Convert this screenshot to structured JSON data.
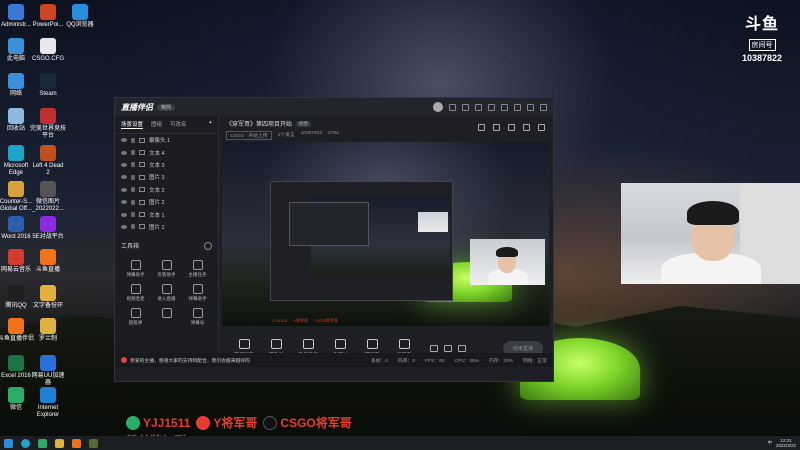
{
  "desktop": {
    "icons": [
      {
        "label": "Administr...",
        "color": "#3b78d8",
        "icon": "user-folder-icon"
      },
      {
        "label": "PowerPoi...",
        "color": "#d04423",
        "icon": "powerpoint-icon"
      },
      {
        "label": "QQ浏览器",
        "color": "#2a8ee0",
        "icon": "qq-browser-icon"
      },
      {
        "label": "此电脑",
        "color": "#3a8fd8",
        "icon": "computer-icon"
      },
      {
        "label": "CSGO.CFG",
        "color": "#e8e8e8",
        "icon": "file-icon"
      },
      {
        "label": "网络",
        "color": "#3a8fd8",
        "icon": "network-icon"
      },
      {
        "label": "Steam",
        "color": "#1b2838",
        "icon": "steam-icon"
      },
      {
        "label": "回收站",
        "color": "#8fb8de",
        "icon": "recycle-bin-icon"
      },
      {
        "label": "完美世界竞技平台",
        "color": "#c03030",
        "icon": "perfect-world-icon"
      },
      {
        "label": "Microsoft Edge",
        "color": "#1fa3c9",
        "icon": "edge-icon"
      },
      {
        "label": "Left 4 Dead 2",
        "color": "#c05020",
        "icon": "l4d2-icon"
      },
      {
        "label": "Counter-S... Global Off...",
        "color": "#d8a23a",
        "icon": "csgo-icon"
      },
      {
        "label": "微信图片_2022022...",
        "color": "#555",
        "icon": "image-icon"
      },
      {
        "label": "Word 2016",
        "color": "#2b5fad",
        "icon": "word-icon"
      },
      {
        "label": "5E对战平台",
        "color": "#8a2be2",
        "icon": "5e-icon"
      },
      {
        "label": "网易云音乐",
        "color": "#d33a31",
        "icon": "netease-music-icon"
      },
      {
        "label": "斗鱼直播",
        "color": "#f2721c",
        "icon": "douyu-icon"
      },
      {
        "label": "腾讯QQ",
        "color": "#1f1f1f",
        "icon": "qq-icon"
      },
      {
        "label": "文字备份环",
        "color": "#e0b040",
        "icon": "note-icon"
      },
      {
        "label": "斗鱼直播伴侣",
        "color": "#f2721c",
        "icon": "douyu-companion-icon"
      },
      {
        "label": "罗兰制",
        "color": "#e0b040",
        "icon": "app-icon"
      },
      {
        "label": "Excel 2016",
        "color": "#1f7244",
        "icon": "excel-icon"
      },
      {
        "label": "网易UU加速器",
        "color": "#2a6fd8",
        "icon": "uu-icon"
      },
      {
        "label": "微信",
        "color": "#2aae67",
        "icon": "wechat-icon"
      },
      {
        "label": "Internet Explorer",
        "color": "#1f7fd6",
        "icon": "ie-icon"
      }
    ]
  },
  "brand": {
    "logo": "斗鱼",
    "room_label": "房间号",
    "room_number": "10387822"
  },
  "app": {
    "name": "直播伴侣",
    "badge": "精简",
    "sidebar": {
      "tabs": [
        "场景设置",
        "图组",
        "可改名"
      ],
      "plus": "+",
      "sources": [
        "摄像头 1",
        "文本 4",
        "文本 3",
        "图片 3",
        "文本 2",
        "图片 2",
        "文本 1",
        "图片 1"
      ],
      "tools_title": "工具箱",
      "tools": [
        "弹幕助手",
        "房管助手",
        "主播任务",
        "视频连麦",
        "进入直播",
        "弹幕助手",
        "超级弹",
        "",
        "弹幕号"
      ]
    },
    "stream": {
      "title": "《穿军哥》第四项目开始",
      "edit": "修改",
      "category": "CSGO · 开始上传",
      "meta_1": "1个发言",
      "room": "10387822",
      "viewers": "2794"
    },
    "controls": [
      "直播屏幕",
      "摄像头",
      "手机投屏",
      "多媒体",
      "游戏房",
      "弹声音"
    ],
    "go_live": "结束直播",
    "status": {
      "notice": "亲爱的主播，感谢大家的支持和配合，我们会越来越好的",
      "stats": [
        "丢帧：0",
        "码率：0",
        "FPS：60",
        "CPU：25%",
        "内存：33%",
        "网络：正常"
      ]
    }
  },
  "overlay": {
    "wechat": "YJJ1511",
    "weibo": "Y将军哥",
    "douyin": "CSGO将军哥",
    "fans": "粉丝牌加群"
  },
  "taskbar": {
    "time": "12:31",
    "date": "2022/3/22",
    "lang": "中"
  }
}
